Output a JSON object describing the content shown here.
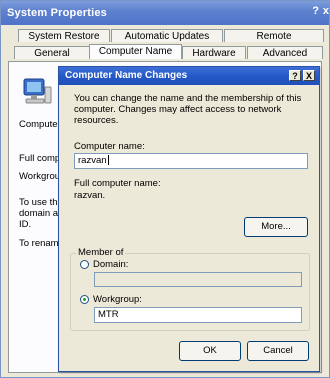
{
  "back_window": {
    "title": "System Properties",
    "help": "?",
    "close": "x",
    "tabs_row1": [
      "System Restore",
      "Automatic Updates",
      "Remote"
    ],
    "tabs_row2": [
      "General",
      "Computer Name",
      "Hardware",
      "Advanced"
    ],
    "clipped_labels": {
      "computer": "Computer",
      "full_comp": "Full comp",
      "workgroup": "Workgrou",
      "to_use_1": "To use th",
      "to_use_2": "domain a",
      "to_use_3": "ID.",
      "to_rename": "To renam"
    }
  },
  "dialog": {
    "title": "Computer Name Changes",
    "help": "?",
    "close": "X",
    "intro": "You can change the name and the membership of this computer. Changes may affect access to network resources.",
    "computer_name_label": "Computer name:",
    "computer_name_value": "razvan",
    "full_name_label": "Full computer name:",
    "full_name_value": "razvan.",
    "more_button": "More...",
    "member_of_label": "Member of",
    "domain_label": "Domain:",
    "domain_value": "",
    "workgroup_label": "Workgroup:",
    "workgroup_value": "MTR",
    "ok_button": "OK",
    "cancel_button": "Cancel"
  }
}
